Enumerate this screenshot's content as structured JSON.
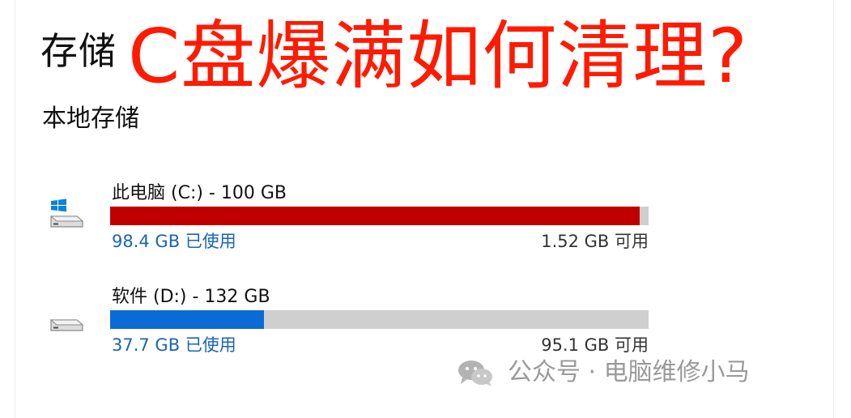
{
  "header": {
    "page_title": "存储",
    "overlay_title": "C盘爆满如何清理?"
  },
  "section": {
    "title": "本地存储"
  },
  "drives": [
    {
      "name": "此电脑 (C:) - 100 GB",
      "used_text": "98.4 GB 已使用",
      "free_text": "1.52 GB 可用",
      "usage_percent": 98.4,
      "bar_color": "#c00000"
    },
    {
      "name": "软件 (D:) - 132 GB",
      "used_text": "37.7 GB 已使用",
      "free_text": "95.1 GB 可用",
      "usage_percent": 28.56,
      "bar_color": "#0a6bd6"
    }
  ],
  "watermark": {
    "text": "公众号 · 电脑维修小马",
    "icon": "wechat-icon"
  },
  "colors": {
    "overlay_title": "#ff1a00",
    "link_blue": "#1a64b8",
    "bar_bg": "#cfcfcf",
    "watermark": "#9a9a9a"
  }
}
